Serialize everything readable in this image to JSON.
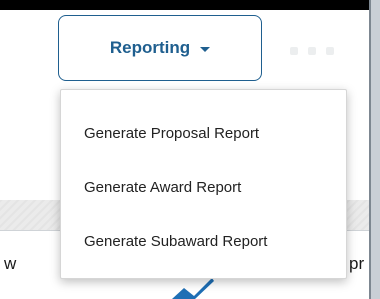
{
  "toolbar": {
    "reporting_label": "Reporting"
  },
  "dropdown": {
    "items": [
      {
        "label": "Generate Proposal Report"
      },
      {
        "label": "Generate Award Report"
      },
      {
        "label": "Generate Subaward Report"
      }
    ]
  },
  "background": {
    "left_fragment": "w",
    "right_fragment": "pr"
  },
  "colors": {
    "accent": "#1f5f8f",
    "menu_text": "#222222",
    "band": "#ebebeb"
  },
  "icons": {
    "caret": "chevron-down-icon",
    "check": "checkmark-icon"
  }
}
